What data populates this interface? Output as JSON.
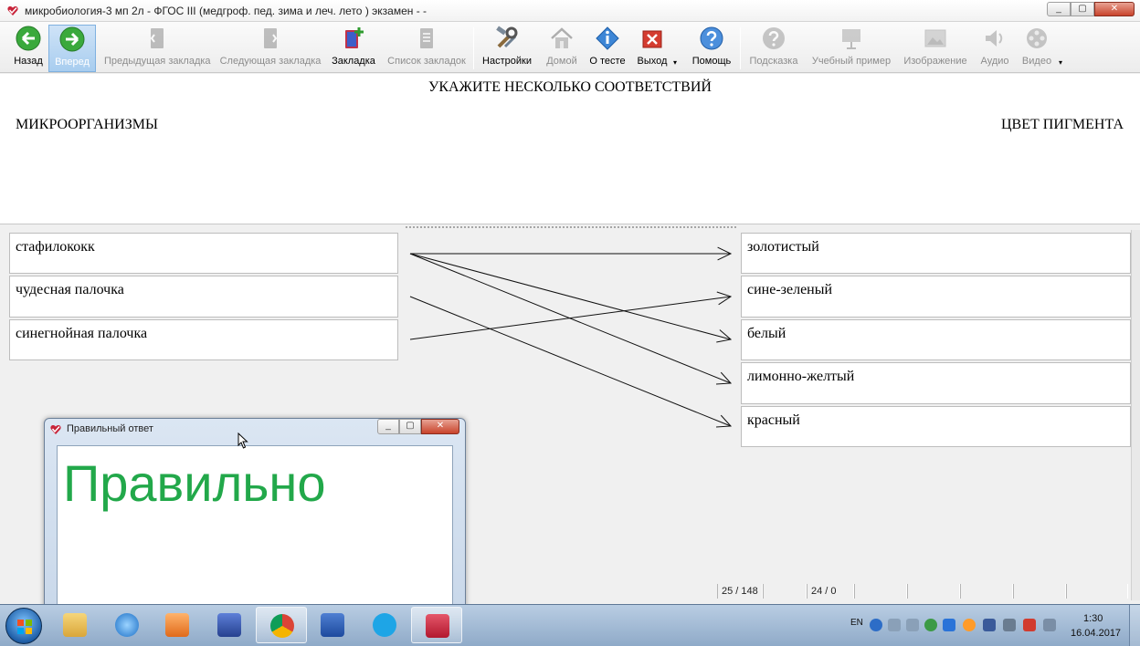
{
  "window": {
    "title": "микробиология-3 мп 2л - ФГОС III (медгроф. пед. зима и леч. лето ) экзамен -  -",
    "controls": [
      "_",
      "▢",
      "✕"
    ]
  },
  "toolbar": {
    "back": "Назад",
    "forward": "Вперед",
    "prev_bookmark": "Предыдущая закладка",
    "next_bookmark": "Следующая закладка",
    "bookmark": "Закладка",
    "bookmark_list": "Список закладок",
    "settings": "Настройки",
    "home": "Домой",
    "about": "О тесте",
    "exit": "Выход",
    "help": "Помощь",
    "hint": "Подсказка",
    "example": "Учебный пример",
    "image": "Изображение",
    "audio": "Аудио",
    "video": "Видео",
    "dropdown_glyph": "▾"
  },
  "question": {
    "title": "УКАЖИТЕ НЕСКОЛЬКО СООТВЕТСТВИЙ",
    "left_header": "МИКРООРГАНИЗМЫ",
    "right_header": "ЦВЕТ ПИГМЕНТА"
  },
  "left_items": [
    "стафилококк",
    "чудесная палочка",
    "синегнойная палочка"
  ],
  "right_items": [
    "золотистый",
    "сине-зеленый",
    "белый",
    "лимонно-желтый",
    "красный"
  ],
  "matches": [
    {
      "from": 0,
      "to": 0
    },
    {
      "from": 0,
      "to": 2
    },
    {
      "from": 0,
      "to": 3
    },
    {
      "from": 1,
      "to": 4
    },
    {
      "from": 2,
      "to": 1
    }
  ],
  "status": {
    "question_counter": "25 / 148",
    "score": "24 / 0"
  },
  "popup": {
    "title": "Правильный ответ",
    "answer": "Правильно",
    "answer_color": "#22a84a"
  },
  "taskbar": {
    "lang": "EN",
    "time": "1:30",
    "date": "16.04.2017"
  }
}
